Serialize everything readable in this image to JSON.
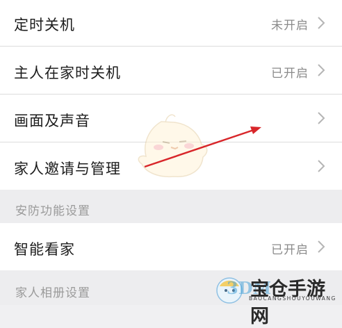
{
  "settings": {
    "rows": [
      {
        "label": "定时关机",
        "value": "未开启"
      },
      {
        "label": "主人在家时关机",
        "value": "已开启"
      },
      {
        "label": "画面及声音",
        "value": ""
      },
      {
        "label": "家人邀请与管理",
        "value": ""
      }
    ],
    "security_section": {
      "title": "安防功能设置",
      "rows": [
        {
          "label": "智能看家",
          "value": "已开启"
        }
      ]
    },
    "album_section": {
      "title": "家人相册设置"
    }
  },
  "watermark": {
    "brand": "宝仓手游网",
    "site": "BAOCANGSHOUYOUWANG",
    "logo_text": "3DM"
  },
  "colors": {
    "annotation_arrow": "#d8262a",
    "section_bg": "#ededef",
    "value_gray": "#8a8a8a"
  }
}
